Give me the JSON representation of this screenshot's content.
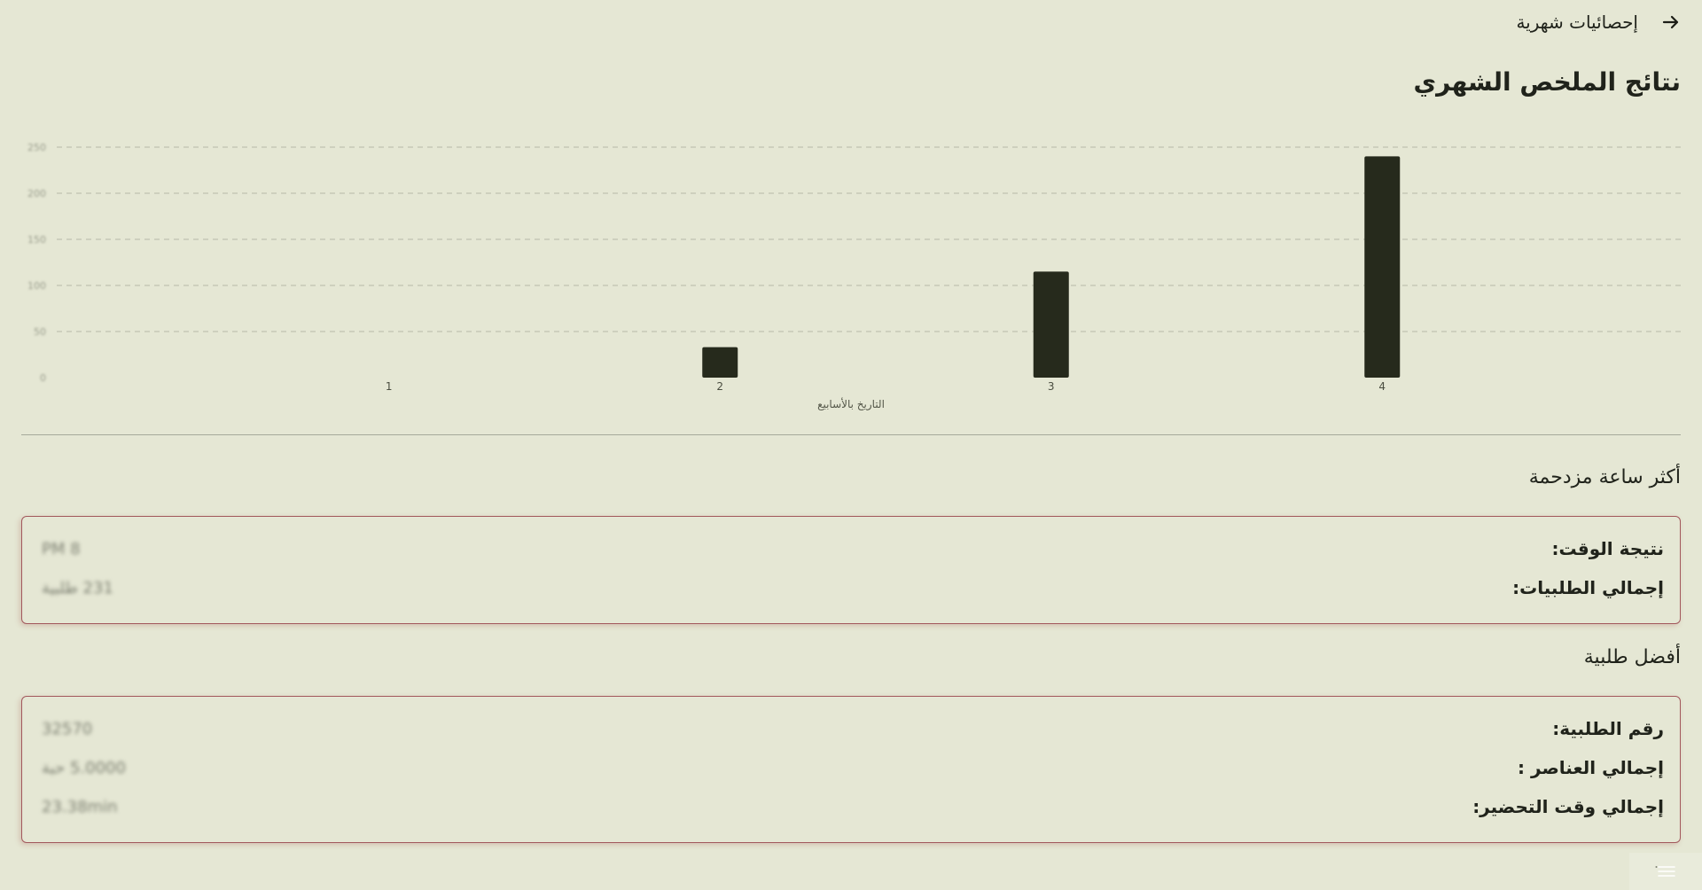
{
  "header": {
    "back_icon": "arrow-right-icon",
    "title": "إحصائيات شهرية"
  },
  "page_title": "نتائج الملخص الشهري",
  "chart_data": {
    "type": "bar",
    "categories": [
      "1",
      "2",
      "3",
      "4"
    ],
    "values": [
      0,
      33,
      115,
      240
    ],
    "xlabel": "التاريخ بالأسابيع",
    "ylabel": "",
    "ylim": [
      0,
      250
    ],
    "yticks": [
      "0",
      "50",
      "100",
      "150",
      "200",
      "250"
    ],
    "grid": true,
    "bar_color": "#262a1c",
    "grid_color": "#c0c3b0"
  },
  "busiest_hour": {
    "title": "أكثر ساعة مزدحمة",
    "rows": [
      {
        "label": "نتيجة الوقت:",
        "value": "8 PM"
      },
      {
        "label": "إجمالي الطلبيات:",
        "value": "231 طلبية"
      }
    ]
  },
  "best_order": {
    "title": "أفضل طلبية",
    "rows": [
      {
        "label": "رقم الطلبية:",
        "value": "32570"
      },
      {
        "label": "إجمالي العناصر :",
        "value": "5.0000 حبة"
      },
      {
        "label": "إجمالي وقت التحضير:",
        "value": "23.38min"
      }
    ]
  },
  "colors": {
    "background": "#e5e7d4",
    "accent_border": "#a2585c",
    "text": "#20231b"
  },
  "corner_widget_icon": "menu-lines-icon"
}
